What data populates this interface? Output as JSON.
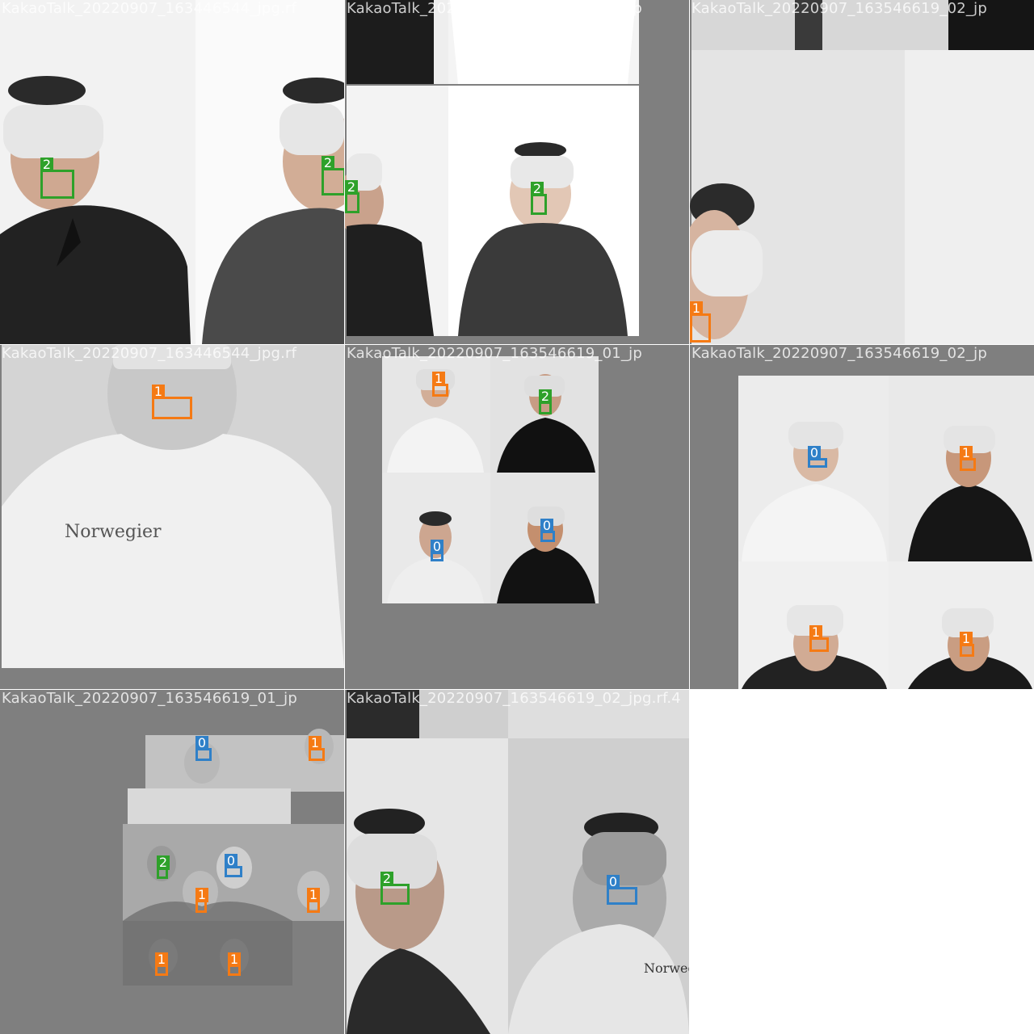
{
  "colors": {
    "class_0": "#2f80c8",
    "class_1": "#f57a14",
    "class_2": "#2ea12a",
    "padding": "#7f7f7f",
    "wall": "#ededed",
    "headset": "#e8e8e8"
  },
  "tiles": [
    {
      "title": "KakaoTalk_20220907_163446544_jpg.rf",
      "boxes": [
        {
          "label": "2"
        },
        {
          "label": "2"
        }
      ]
    },
    {
      "title": "KakaoTalk_20220907_163546619_01_jp",
      "boxes": [
        {
          "label": "2"
        },
        {
          "label": "2"
        }
      ]
    },
    {
      "title": "KakaoTalk_20220907_163546619_02_jp",
      "boxes": [
        {
          "label": "1"
        }
      ]
    },
    {
      "title": "KakaoTalk_20220907_163446544_jpg.rf",
      "boxes": [
        {
          "label": "1"
        }
      ]
    },
    {
      "title": "KakaoTalk_20220907_163546619_01_jp",
      "boxes": [
        {
          "label": "1"
        },
        {
          "label": "2"
        },
        {
          "label": "0"
        },
        {
          "label": "0"
        }
      ]
    },
    {
      "title": "KakaoTalk_20220907_163546619_02_jp",
      "boxes": [
        {
          "label": "0"
        },
        {
          "label": "1"
        },
        {
          "label": "1"
        },
        {
          "label": "1"
        }
      ]
    },
    {
      "title": "KakaoTalk_20220907_163546619_01_jp",
      "boxes": [
        {
          "label": "0"
        },
        {
          "label": "1"
        },
        {
          "label": "2"
        },
        {
          "label": "0"
        },
        {
          "label": "1"
        },
        {
          "label": "1"
        },
        {
          "label": "1"
        },
        {
          "label": "1"
        }
      ]
    },
    {
      "title": "KakaoTalk_20220907_163546619_02_jpg.rf.4",
      "boxes": [
        {
          "label": "2"
        },
        {
          "label": "0"
        }
      ]
    }
  ]
}
